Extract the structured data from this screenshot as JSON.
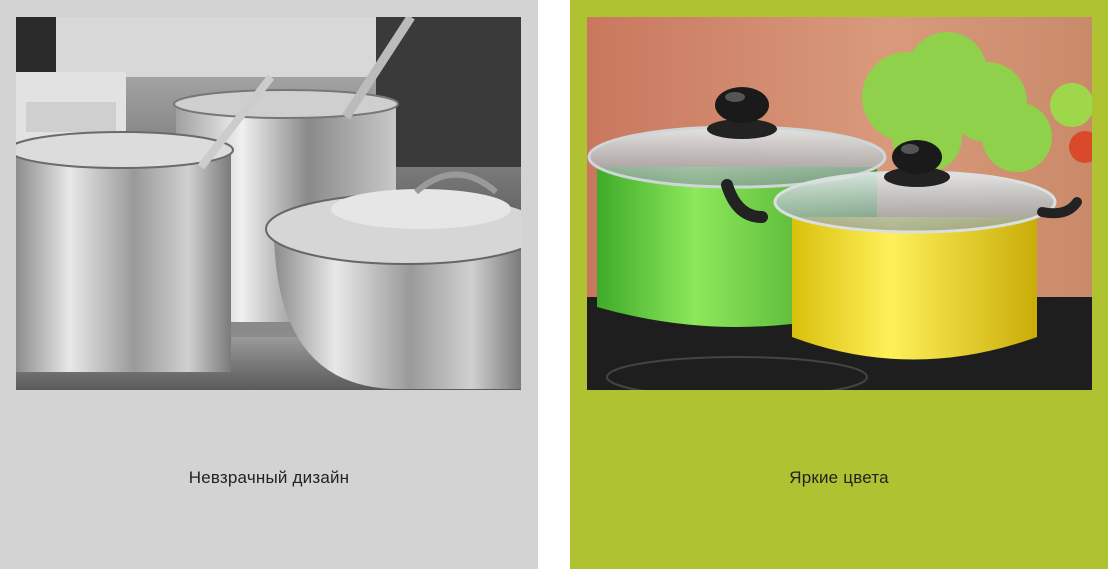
{
  "panels": [
    {
      "caption": "Невзрачный дизайн",
      "background": "#d3d3d3",
      "image": "steel-pots-photo"
    },
    {
      "caption": "Яркие цвета",
      "background": "#afc232",
      "image": "colorful-pots-photo"
    }
  ],
  "colors": {
    "green_pot": "#6ed83a",
    "yellow_pot": "#f2dc16",
    "lettuce": "#8fd14a"
  }
}
